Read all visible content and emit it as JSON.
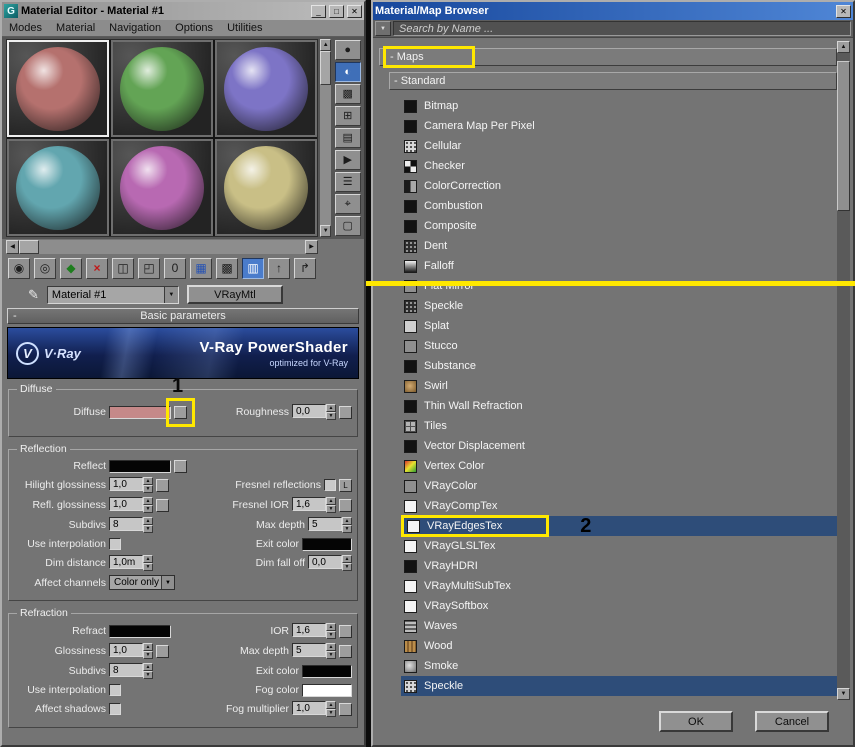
{
  "annotations": {
    "one": "1",
    "two": "2",
    "highlight_color": "#ffe800"
  },
  "ui": {
    "arrow_up": "▲",
    "arrow_down": "▼",
    "arrow_left": "◀",
    "arrow_right": "▶"
  },
  "editor": {
    "title": "Material Editor - Material #1",
    "app_icon_letter": "G",
    "window_buttons": {
      "min": "_",
      "max": "□",
      "close": "✕"
    },
    "menus": [
      "Modes",
      "Material",
      "Navigation",
      "Options",
      "Utilities"
    ],
    "slots": {
      "sphere_colors": [
        "#b5716e",
        "#63a455",
        "#7d74c6",
        "#62a6af",
        "#b869b2",
        "#c9bf86"
      ]
    },
    "side_toolbar": [
      {
        "name": "sample-type-button",
        "glyph": "●"
      },
      {
        "name": "backlight-button",
        "glyph": "◐",
        "pressed": true
      },
      {
        "name": "background-button",
        "glyph": "▩"
      },
      {
        "name": "sample-uv-tiling-button",
        "glyph": "⊞"
      },
      {
        "name": "video-color-check-button",
        "glyph": "▤"
      },
      {
        "name": "make-preview-button",
        "glyph": "▶"
      },
      {
        "name": "options-button",
        "glyph": "☰"
      },
      {
        "name": "select-by-material-button",
        "glyph": "⌖"
      },
      {
        "name": "material-map-navigator-button",
        "glyph": "▢"
      }
    ],
    "toolbar": [
      {
        "name": "get-material-button",
        "glyph": "◉"
      },
      {
        "name": "put-material-to-scene-button",
        "glyph": "◎"
      },
      {
        "name": "assign-material-to-selection-button",
        "glyph": "◆",
        "color": "green"
      },
      {
        "name": "reset-map-button",
        "glyph": "×",
        "color": "red"
      },
      {
        "name": "make-material-copy-button",
        "glyph": "◫"
      },
      {
        "name": "put-to-library-button",
        "glyph": "◰"
      },
      {
        "name": "material-id-channel-button",
        "glyph": "0"
      },
      {
        "name": "show-material-in-viewport-button",
        "glyph": "▦",
        "color": "blue"
      },
      {
        "name": "show-end-result-button",
        "glyph": "▩"
      },
      {
        "name": "show-background-button",
        "glyph": "▥",
        "pressed": true
      },
      {
        "name": "go-to-parent-button",
        "glyph": "↑"
      },
      {
        "name": "go-forward-to-sibling-button",
        "glyph": "↱"
      }
    ],
    "pick_icon": "✎",
    "material_name": "Material #1",
    "material_type": "VRayMtl",
    "rollout_basic": "Basic parameters",
    "rollout_minus": "-",
    "banner": {
      "logo": "V·Ray",
      "title": "V-Ray PowerShader",
      "subtitle": "optimized for V-Ray"
    },
    "params": {
      "diffuse": {
        "legend": "Diffuse",
        "rows": [
          [
            {
              "l": "Diffuse"
            },
            {
              "sw": "#c58989",
              "wide": true
            },
            {
              "b": 1,
              "ann": true
            },
            {
              "l": "Roughness"
            },
            {
              "sp": "0,0"
            },
            {
              "b": 1
            }
          ]
        ]
      },
      "reflection": {
        "legend": "Reflection",
        "rows": [
          [
            {
              "l": "Reflect"
            },
            {
              "sw": "#050505",
              "wide": true
            },
            {
              "b": 1
            },
            {
              "g": 1
            }
          ],
          [
            {
              "l": "Hilight glossiness"
            },
            {
              "sp": "1,0"
            },
            {
              "b": 1
            },
            {
              "l": "Fresnel reflections"
            },
            {
              "ck": 0
            },
            {
              "b": 1,
              "t": "L"
            }
          ],
          [
            {
              "l": "Refl. glossiness"
            },
            {
              "sp": "1,0"
            },
            {
              "b": 1
            },
            {
              "l": "Fresnel IOR"
            },
            {
              "sp": "1,6"
            },
            {
              "b": 1
            }
          ],
          [
            {
              "l": "Subdivs"
            },
            {
              "sp": "8"
            },
            {
              "l": "Max depth"
            },
            {
              "sp": "5"
            }
          ],
          [
            {
              "l": "Use interpolation"
            },
            {
              "ck": 0
            },
            {
              "l": "Exit color"
            },
            {
              "sw": "#050505"
            }
          ],
          [
            {
              "l": "Dim distance"
            },
            {
              "sp": "1,0m"
            },
            {
              "l": "Dim fall off"
            },
            {
              "sp": "0,0"
            }
          ],
          [
            {
              "l": "Affect channels"
            },
            {
              "dd": "Color only"
            },
            {
              "g": 1
            }
          ]
        ]
      },
      "refraction": {
        "legend": "Refraction",
        "rows": [
          [
            {
              "l": "Refract"
            },
            {
              "sw": "#050505",
              "wide": true
            },
            {
              "l": "IOR"
            },
            {
              "sp": "1,6"
            },
            {
              "b": 1
            }
          ],
          [
            {
              "l": "Glossiness"
            },
            {
              "sp": "1,0"
            },
            {
              "b": 1
            },
            {
              "l": "Max depth"
            },
            {
              "sp": "5"
            },
            {
              "b": 1
            }
          ],
          [
            {
              "l": "Subdivs"
            },
            {
              "sp": "8"
            },
            {
              "l": "Exit color"
            },
            {
              "sw": "#050505"
            }
          ],
          [
            {
              "l": "Use interpolation"
            },
            {
              "ck": 0
            },
            {
              "l": "Fog color"
            },
            {
              "sw": "#ffffff"
            }
          ],
          [
            {
              "l": "Affect shadows"
            },
            {
              "ck": 0
            },
            {
              "l": "Fog multiplier"
            },
            {
              "sp": "1,0"
            },
            {
              "b": 1
            }
          ]
        ]
      }
    }
  },
  "browser": {
    "title": "Material/Map Browser",
    "close_glyph": "✕",
    "search_text": "Search by Name ...",
    "groups": [
      {
        "label": "- Maps",
        "annotated": true
      },
      {
        "label": "- Standard"
      }
    ],
    "items": [
      {
        "label": "Bitmap",
        "icon": "dark"
      },
      {
        "label": "Camera Map Per Pixel",
        "icon": "dark"
      },
      {
        "label": "Cellular",
        "icon": "speckle-light"
      },
      {
        "label": "Checker",
        "icon": "checker"
      },
      {
        "label": "ColorCorrection",
        "icon": "half"
      },
      {
        "label": "Combustion",
        "icon": "dark"
      },
      {
        "label": "Composite",
        "icon": "dark"
      },
      {
        "label": "Dent",
        "icon": "speckle-dark"
      },
      {
        "label": "Falloff",
        "icon": "grad"
      },
      {
        "label": "Flat Mirror",
        "icon": "gray"
      },
      {
        "label": "Speckle",
        "icon": "speckle-dark"
      },
      {
        "label": "Splat",
        "icon": "light"
      },
      {
        "label": "Stucco",
        "icon": "gray"
      },
      {
        "label": "Substance",
        "icon": "dark"
      },
      {
        "label": "Swirl",
        "icon": "swirl"
      },
      {
        "label": "Thin Wall Refraction",
        "icon": "dark"
      },
      {
        "label": "Tiles",
        "icon": "tiles"
      },
      {
        "label": "Vector Displacement",
        "icon": "dark"
      },
      {
        "label": "Vertex Color",
        "icon": "vertex"
      },
      {
        "label": "VRayColor",
        "icon": "gray"
      },
      {
        "label": "VRayCompTex",
        "icon": "white"
      },
      {
        "label": "VRayEdgesTex",
        "icon": "white",
        "selected": true,
        "annotated": true
      },
      {
        "label": "VRayGLSLTex",
        "icon": "white"
      },
      {
        "label": "VRayHDRI",
        "icon": "dark"
      },
      {
        "label": "VRayMultiSubTex",
        "icon": "white"
      },
      {
        "label": "VRaySoftbox",
        "icon": "white"
      },
      {
        "label": "Waves",
        "icon": "waves"
      },
      {
        "label": "Wood",
        "icon": "wood"
      },
      {
        "label": "Smoke",
        "icon": "smoke"
      },
      {
        "label": "Speckle",
        "icon": "speckle-light",
        "selected": true
      }
    ],
    "ok": "OK",
    "cancel": "Cancel"
  }
}
